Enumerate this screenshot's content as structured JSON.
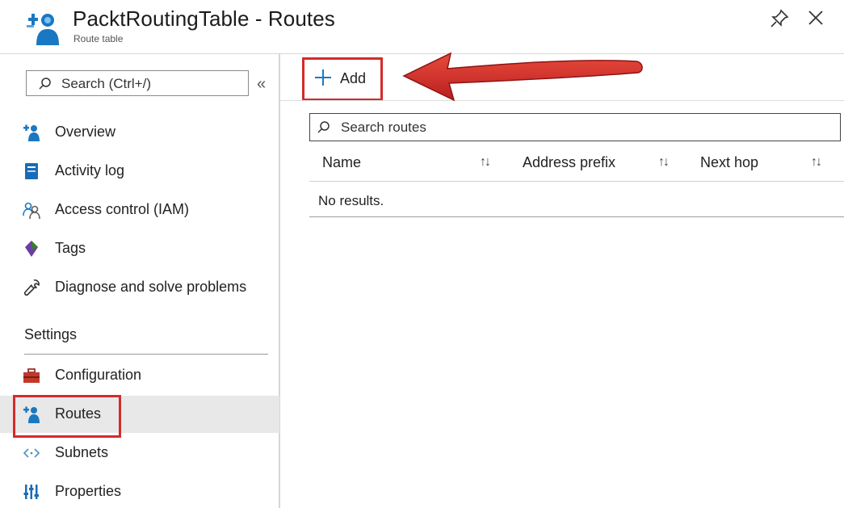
{
  "header": {
    "title": "PacktRoutingTable - Routes",
    "subtitle": "Route table",
    "icon": "route-table-icon",
    "pin_icon": "pin-icon",
    "close_icon": "close-icon"
  },
  "sidebar": {
    "search_placeholder": "Search (Ctrl+/)",
    "collapse_label": "«",
    "items": [
      {
        "label": "Overview",
        "icon": "route-table-icon"
      },
      {
        "label": "Activity log",
        "icon": "activity-log-icon"
      },
      {
        "label": "Access control (IAM)",
        "icon": "people-icon"
      },
      {
        "label": "Tags",
        "icon": "tag-icon"
      },
      {
        "label": "Diagnose and solve problems",
        "icon": "wrench-icon"
      }
    ],
    "settings_header": "Settings",
    "settings_items": [
      {
        "label": "Configuration",
        "icon": "toolbox-icon"
      },
      {
        "label": "Routes",
        "icon": "route-table-icon",
        "selected": true
      },
      {
        "label": "Subnets",
        "icon": "code-brackets-icon"
      },
      {
        "label": "Properties",
        "icon": "properties-icon"
      }
    ]
  },
  "toolbar": {
    "add_label": "Add"
  },
  "routes": {
    "search_placeholder": "Search routes",
    "columns": [
      "Name",
      "Address prefix",
      "Next hop"
    ],
    "empty_text": "No results."
  },
  "colors": {
    "highlight": "#d52b2b",
    "azure_blue": "#1a78c2",
    "selected_bg": "#e8e8e8"
  }
}
